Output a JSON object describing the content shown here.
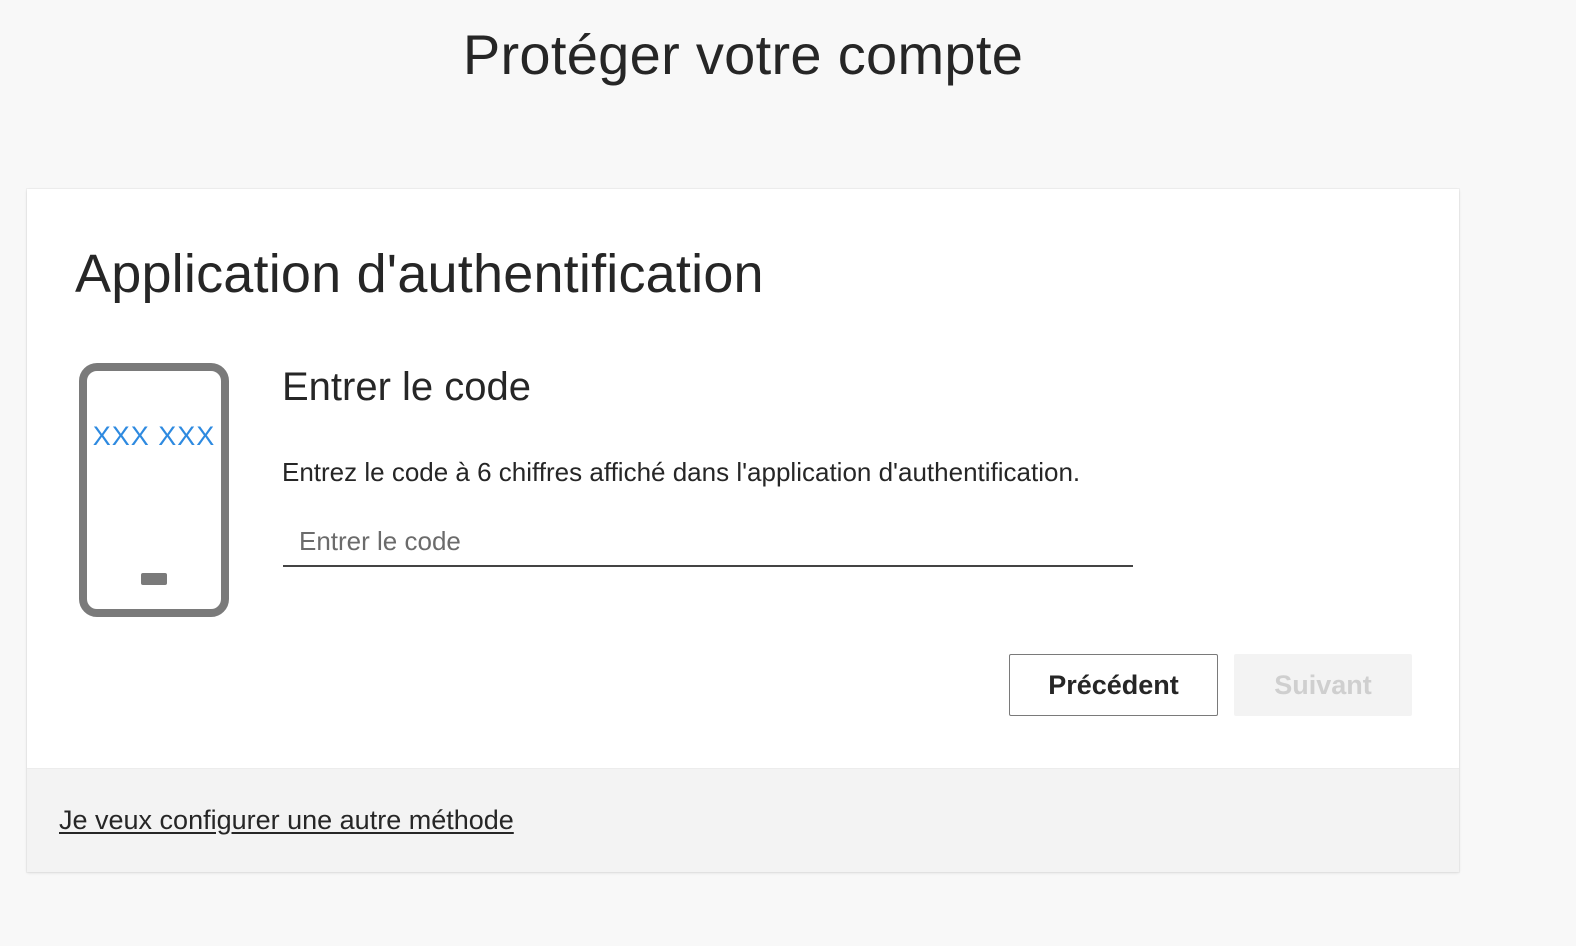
{
  "header": {
    "title": "Protéger votre compte"
  },
  "card": {
    "title": "Application d'authentification",
    "illustration": {
      "icon": "phone-icon",
      "code_placeholder": "XXX XXX",
      "code_color": "#2e8ae0"
    },
    "section_heading": "Entrer le code",
    "instruction": "Entrez le code à 6 chiffres affiché dans l'application d'authentification.",
    "code_input": {
      "value": "",
      "placeholder": "Entrer le code"
    },
    "buttons": {
      "back_label": "Précédent",
      "next_label": "Suivant"
    },
    "footer": {
      "link_label": "Je veux configurer une autre méthode"
    }
  },
  "colors": {
    "page_background": "#f8f8f8",
    "card_background": "#ffffff",
    "footer_background": "#f3f3f3",
    "text": "#262626",
    "phone_outline": "#7a7a7a",
    "disabled_button_text": "#cfcfcf"
  }
}
